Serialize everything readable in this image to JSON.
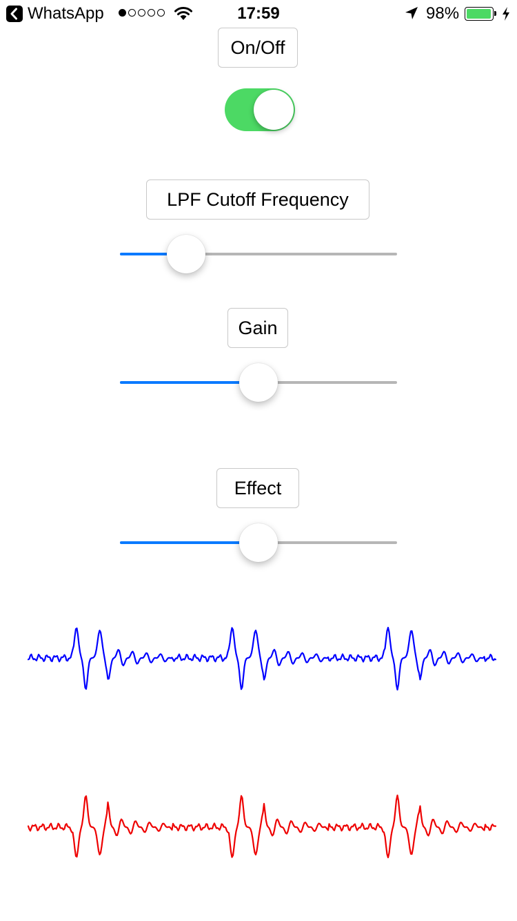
{
  "status_bar": {
    "back_app": "WhatsApp",
    "signal_bars_filled": 1,
    "signal_bars_total": 5,
    "time": "17:59",
    "battery_percent": "98%",
    "battery_level": 0.98,
    "battery_color": "#4cd964",
    "icons": [
      "back-arrow-icon",
      "wifi-icon",
      "location-arrow-icon",
      "battery-icon",
      "charging-bolt-icon"
    ]
  },
  "controls": {
    "on_off": {
      "label": "On/Off",
      "on": true,
      "color": "#4cd964"
    },
    "lpf": {
      "label": "LPF Cutoff Frequency",
      "value": 0.24
    },
    "gain": {
      "label": "Gain",
      "value": 0.5
    },
    "effect": {
      "label": "Effect",
      "value": 0.5
    }
  },
  "colors": {
    "slider_fill": "#0a7aff",
    "slider_track": "#b6b6b6",
    "input_wave": "#0000ff",
    "output_wave": "#ee0000"
  }
}
